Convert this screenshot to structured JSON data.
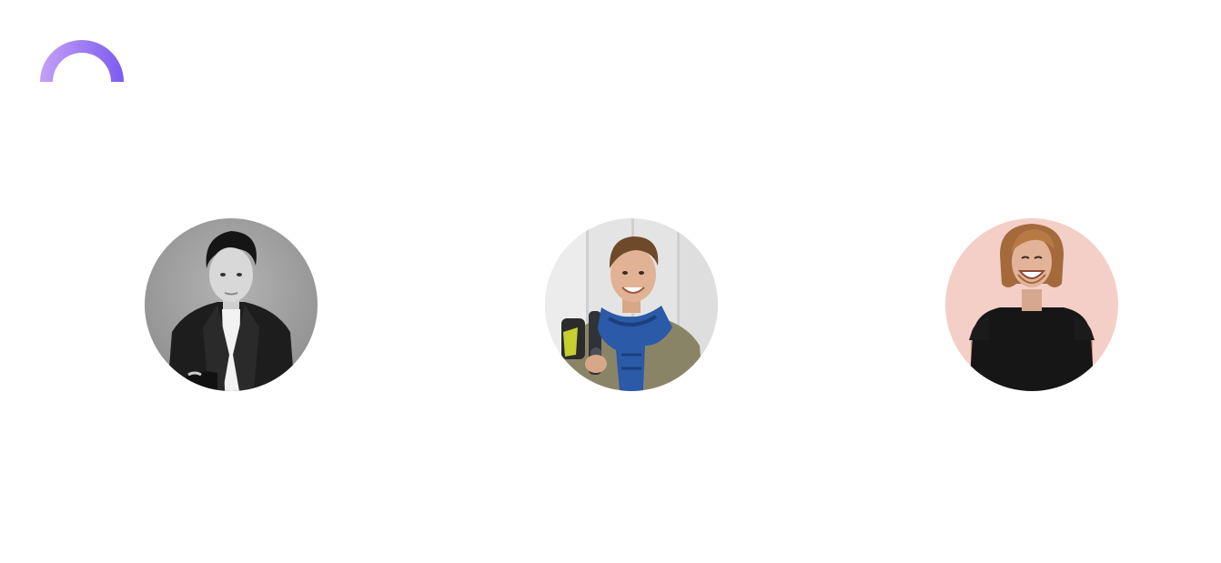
{
  "brand": {
    "logo": "arc-logo",
    "gradient_start": "#c4a0f5",
    "gradient_end": "#7c5cf0"
  },
  "avatars": [
    {
      "icon": "person-photo-icon",
      "background": "#9e9e9e",
      "style": "black-and-white portrait, dark blazer"
    },
    {
      "icon": "person-photo-icon",
      "background": "#e2e2e2",
      "style": "smiling man with blue scarf and backpack"
    },
    {
      "icon": "person-photo-icon",
      "background": "#f3cfc8",
      "style": "long-haired man in black t-shirt on pink background"
    }
  ]
}
